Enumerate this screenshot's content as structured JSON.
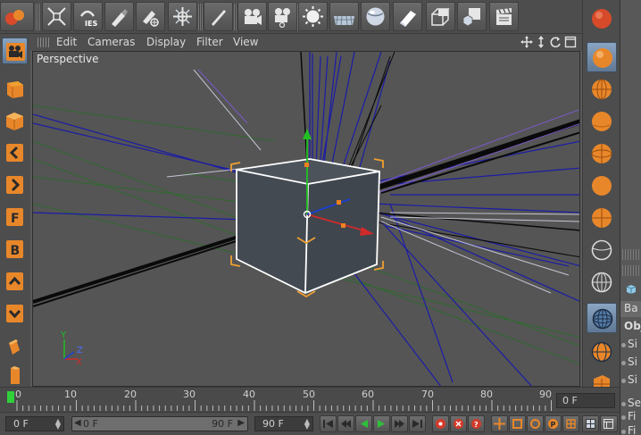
{
  "menu": {
    "items": [
      "Edit",
      "Cameras",
      "Display",
      "Filter",
      "View"
    ]
  },
  "viewport": {
    "label": "Perspective"
  },
  "axis_gizmo": {
    "y": "Y",
    "z": "Z",
    "x": "X"
  },
  "timeline": {
    "ticks": [
      "0",
      "10",
      "20",
      "30",
      "40",
      "50",
      "60",
      "70",
      "80",
      "90"
    ],
    "current_frame": "0 F"
  },
  "controls": {
    "start_field": "0 F",
    "range_start": "0 F",
    "range_end": "90 F",
    "end_field": "90 F"
  },
  "attributes": {
    "tab": "Ba",
    "section": "Obj",
    "rows": [
      "Si",
      "Si",
      "Si",
      "Se",
      "Fi",
      "Fi"
    ]
  },
  "colors": {
    "accent_orange": "#e8872a",
    "selection_blue": "#6f8db0",
    "cube_orange": "#f0a030",
    "play_green": "#2fbf3a",
    "record_red": "#d33a2a"
  },
  "icons": {
    "toolbar": [
      "scene-object-icon",
      "render-region-icon",
      "ies-light-icon",
      "spline-pen-icon",
      "spline-sketch-icon",
      "mesh-tool-icon",
      "brush-icon",
      "camera-icon",
      "target-camera-icon",
      "sky-icon",
      "floor-icon",
      "environment-icon",
      "deformer-icon",
      "cube-outline-icon",
      "object-transform-icon",
      "stage-icon",
      "clapper-icon"
    ],
    "left": [
      "camera-mode-icon",
      "cube-solid-icon",
      "cube-orange-icon",
      "key-left-icon",
      "key-right-icon",
      "f-curve-icon",
      "bone-icon",
      "up-arrow-icon",
      "down-arrow-icon",
      "extrude-icon",
      "bevel-icon"
    ],
    "right": [
      "sphere-red-icon",
      "sphere-orange-icon",
      "sphere-grid-icon",
      "sphere-icon",
      "sphere-wire-icon",
      "sphere-light-icon",
      "sphere-half-icon",
      "sphere-outline-icon",
      "sphere-lat-icon",
      "globe-selected-icon",
      "globe-icon",
      "cube-grid-icon"
    ]
  }
}
